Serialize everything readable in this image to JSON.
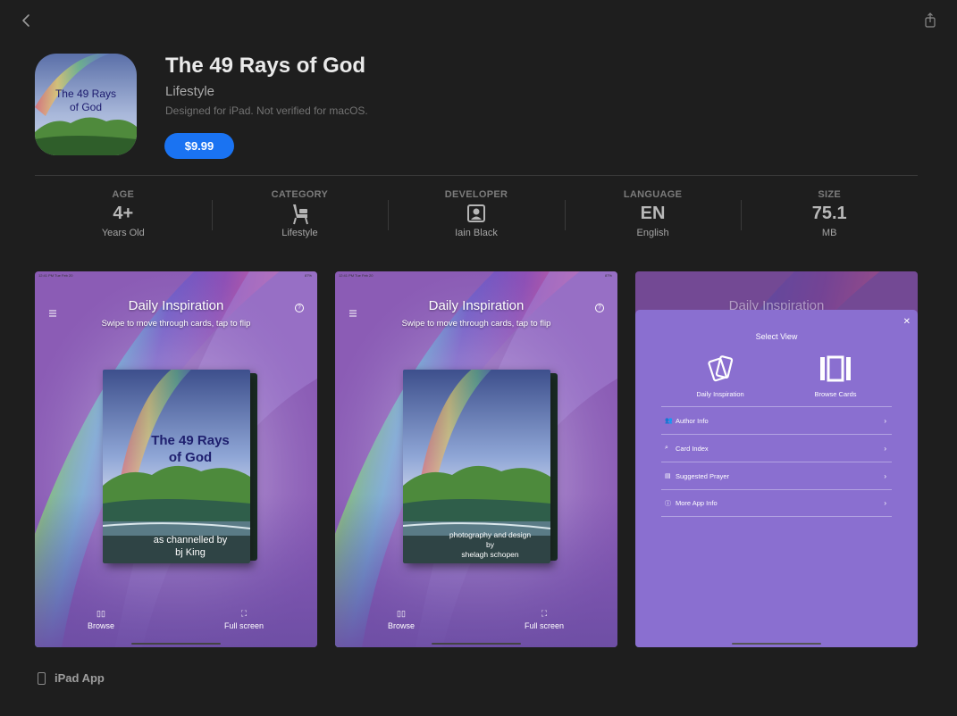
{
  "app": {
    "title": "The 49 Rays of God",
    "category": "Lifestyle",
    "compat_note": "Designed for iPad. Not verified for macOS.",
    "price": "$9.99",
    "icon_text_line1": "The 49 Rays",
    "icon_text_line2": "of God"
  },
  "info": [
    {
      "label": "AGE",
      "value": "4+",
      "sub": "Years Old"
    },
    {
      "label": "CATEGORY",
      "icon": "armchair-icon",
      "sub": "Lifestyle"
    },
    {
      "label": "DEVELOPER",
      "icon": "person-badge-icon",
      "sub": "Iain Black"
    },
    {
      "label": "LANGUAGE",
      "value": "EN",
      "sub": "English"
    },
    {
      "label": "SIZE",
      "value": "75.1",
      "sub": "MB"
    }
  ],
  "screenshots": {
    "status_left": "12:41 PM  Tue Feb 20",
    "status_right": "87%",
    "heading": "Daily Inspiration",
    "subheading": "Swipe to move through cards, tap to flip",
    "card_title_line1": "The 49 Rays",
    "card_title_line2": "of God",
    "card1_foot_line1": "as channelled by",
    "card1_foot_line2": "bj King",
    "card2_foot_line1": "photography and design",
    "card2_foot_line2": "by",
    "card2_foot_line3": "shelagh schopen",
    "browse_label": "Browse",
    "fullscreen_label": "Full screen",
    "sheet": {
      "title": "Select View",
      "option1": "Daily Inspiration",
      "option2": "Browse Cards",
      "items": [
        "Author Info",
        "Card Index",
        "Suggested Prayer",
        "More App Info"
      ]
    }
  },
  "platform_label": "iPad App",
  "colors": {
    "background": "#1e1e1e",
    "accent": "#1a73f2",
    "sheet": "#8a6fd0"
  }
}
